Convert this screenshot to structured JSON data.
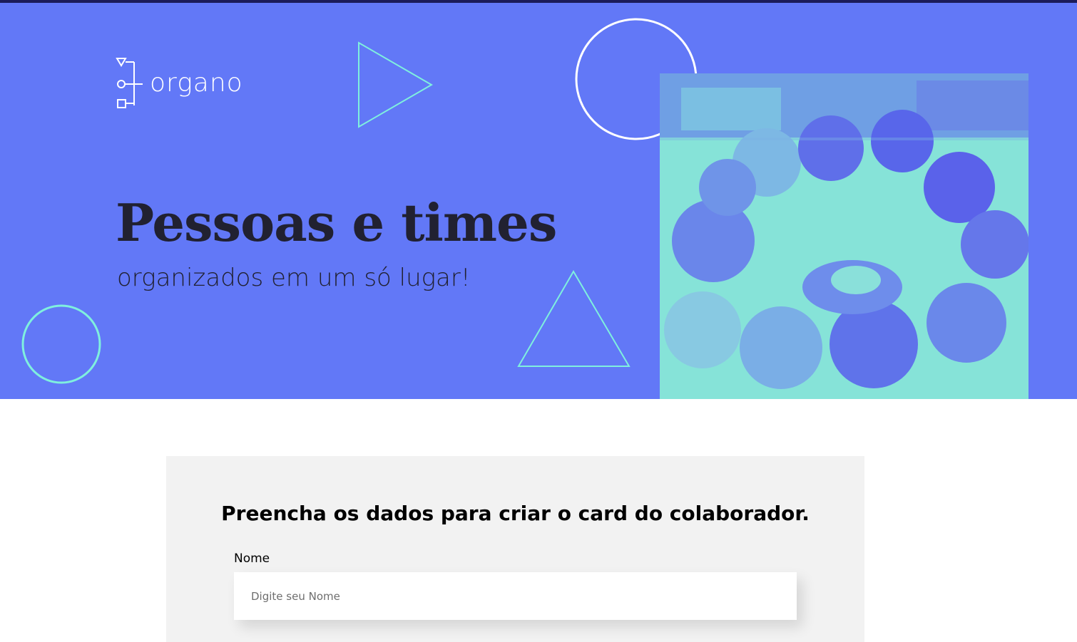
{
  "brand": {
    "name": "organo",
    "logo_icon": "organo-logo-icon"
  },
  "banner": {
    "title": "Pessoas e times",
    "subtitle": "organizados em um só lugar!",
    "photo": "team-hands-together-photo",
    "colors": {
      "background": "#6278f7",
      "accent": "#7ff0de",
      "text": "#212131"
    }
  },
  "form": {
    "heading": "Preencha os dados para criar o card do colaborador.",
    "name_field": {
      "label": "Nome",
      "placeholder": "Digite seu Nome",
      "value": ""
    }
  }
}
